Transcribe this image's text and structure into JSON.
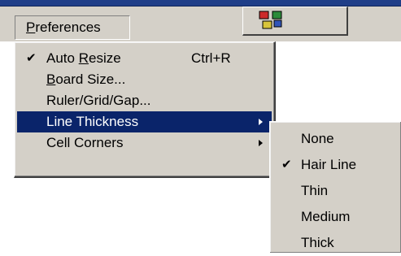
{
  "menubar": {
    "title_prefix": "",
    "title_underlined": "P",
    "title_rest": "references"
  },
  "colors": {
    "menu_bg": "#d4d0c8",
    "selection_bg": "#0a246a",
    "selection_fg": "#ffffff",
    "top_border": "#1f3e88"
  },
  "menu": {
    "items": [
      {
        "checked": true,
        "check": "✔",
        "pre": "Auto ",
        "u": "R",
        "post": "esize",
        "shortcut": "Ctrl+R",
        "has_submenu": false,
        "active": false
      },
      {
        "checked": false,
        "check": "",
        "pre": "",
        "u": "B",
        "post": "oard Size...",
        "shortcut": "",
        "has_submenu": false,
        "active": false
      },
      {
        "checked": false,
        "check": "",
        "pre": "Ruler/Grid/Gap...",
        "u": "",
        "post": "",
        "shortcut": "",
        "has_submenu": false,
        "active": false
      },
      {
        "checked": false,
        "check": "",
        "pre": "Line Thickness",
        "u": "",
        "post": "",
        "shortcut": "",
        "has_submenu": true,
        "active": true
      },
      {
        "checked": false,
        "check": "",
        "pre": "Cell Corners",
        "u": "",
        "post": "",
        "shortcut": "",
        "has_submenu": true,
        "active": false
      }
    ]
  },
  "submenu": {
    "items": [
      {
        "label": "None",
        "checked": false,
        "check": ""
      },
      {
        "label": "Hair Line",
        "checked": true,
        "check": "✔"
      },
      {
        "label": "Thin",
        "checked": false,
        "check": ""
      },
      {
        "label": "Medium",
        "checked": false,
        "check": ""
      },
      {
        "label": "Thick",
        "checked": false,
        "check": ""
      }
    ]
  }
}
